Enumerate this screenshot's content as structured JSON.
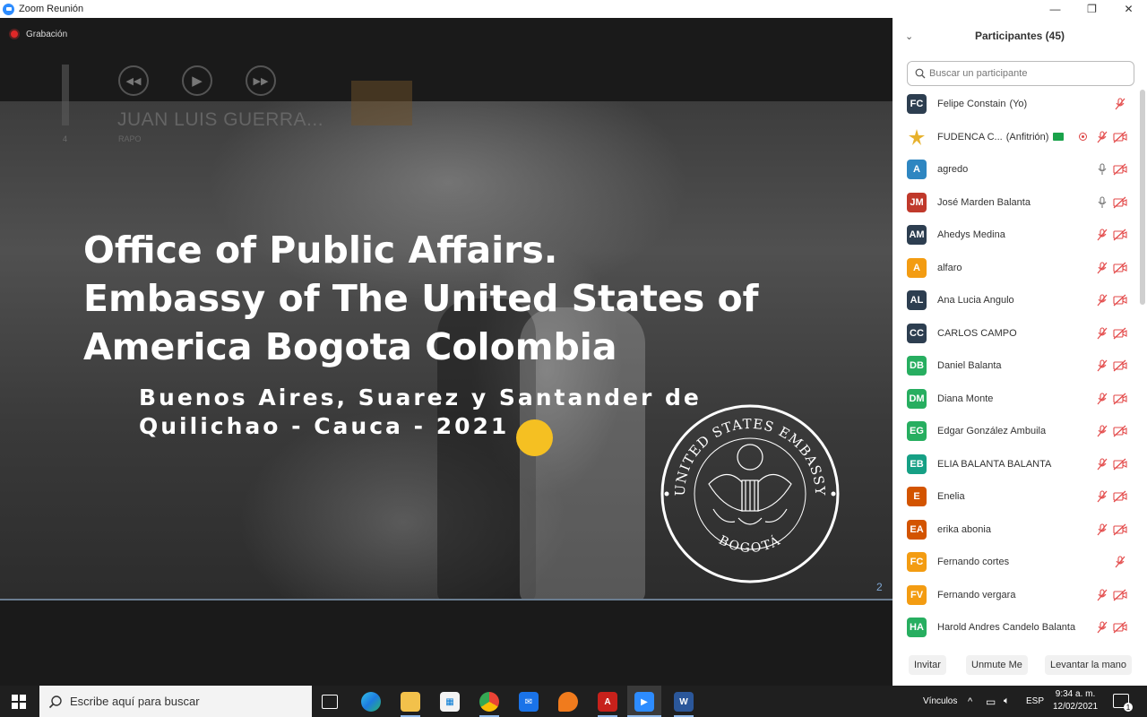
{
  "window": {
    "title": "Zoom Reunión",
    "controls": [
      "—",
      "❐",
      "✕"
    ]
  },
  "meeting": {
    "recording_label": "Grabación",
    "media": {
      "volume_number": "4",
      "song_title": "JUAN LUIS GUERRA...",
      "artist": "RAPO"
    },
    "slide": {
      "title_lines": [
        "Office of Public Affairs.",
        "Embassy of The United States of",
        "America Bogota Colombia"
      ],
      "subtitle_lines": [
        "Buenos Aires, Suarez y Santander de",
        "Quilichao - Cauca - 2021"
      ],
      "page_number": "2",
      "seal_top_text": "UNITED STATES EMBASSY",
      "seal_bottom_text": "BOGOTÁ"
    }
  },
  "panel": {
    "title": "Participantes (45)",
    "search_placeholder": "Buscar un participante",
    "participants": [
      {
        "initials": "FC",
        "name": "Felipe Constain",
        "role": "(Yo)",
        "color": "#2d3e50",
        "mic": "muted",
        "cam": "none"
      },
      {
        "initials": "FUDENCA",
        "name": "FUDENCA C...",
        "role": "(Anfitrión)",
        "color": "logo",
        "mic": "muted",
        "cam": "off",
        "host": true,
        "recording": true
      },
      {
        "initials": "A",
        "name": "agredo",
        "role": "",
        "color": "#2e86c1",
        "mic": "on",
        "cam": "off"
      },
      {
        "initials": "JM",
        "name": "José Marden Balanta",
        "role": "",
        "color": "#c0392b",
        "mic": "on",
        "cam": "off"
      },
      {
        "initials": "AM",
        "name": "Ahedys Medina",
        "role": "",
        "color": "#2d3e50",
        "mic": "muted",
        "cam": "off"
      },
      {
        "initials": "A",
        "name": "alfaro",
        "role": "",
        "color": "#f39c12",
        "mic": "muted",
        "cam": "off"
      },
      {
        "initials": "AL",
        "name": "Ana  Lucia Angulo",
        "role": "",
        "color": "#2d3e50",
        "mic": "muted",
        "cam": "off"
      },
      {
        "initials": "CC",
        "name": "CARLOS CAMPO",
        "role": "",
        "color": "#2d3e50",
        "mic": "muted",
        "cam": "off"
      },
      {
        "initials": "DB",
        "name": "Daniel Balanta",
        "role": "",
        "color": "#27ae60",
        "mic": "muted",
        "cam": "off"
      },
      {
        "initials": "DM",
        "name": "Diana Monte",
        "role": "",
        "color": "#27ae60",
        "mic": "muted",
        "cam": "off"
      },
      {
        "initials": "EG",
        "name": "Edgar González Ambuila",
        "role": "",
        "color": "#27ae60",
        "mic": "muted",
        "cam": "off"
      },
      {
        "initials": "EB",
        "name": "ELIA BALANTA BALANTA",
        "role": "",
        "color": "#16a085",
        "mic": "muted",
        "cam": "off"
      },
      {
        "initials": "E",
        "name": "Enelia",
        "role": "",
        "color": "#d35400",
        "mic": "muted",
        "cam": "off"
      },
      {
        "initials": "EA",
        "name": "erika abonia",
        "role": "",
        "color": "#d35400",
        "mic": "muted",
        "cam": "off"
      },
      {
        "initials": "FC",
        "name": "Fernando cortes",
        "role": "",
        "color": "#f39c12",
        "mic": "muted",
        "cam": "none"
      },
      {
        "initials": "FV",
        "name": "Fernando vergara",
        "role": "",
        "color": "#f39c12",
        "mic": "muted",
        "cam": "off"
      },
      {
        "initials": "HA",
        "name": "Harold Andres Candelo Balanta",
        "role": "",
        "color": "#27ae60",
        "mic": "muted",
        "cam": "off"
      }
    ],
    "footer": {
      "invite": "Invitar",
      "unmute": "Unmute Me",
      "raise_hand": "Levantar la mano"
    }
  },
  "taskbar": {
    "search_placeholder": "Escribe aquí para buscar",
    "tray_label": "Vínculos",
    "language": "ESP",
    "time": "9:34 a. m.",
    "date": "12/02/2021",
    "notification_count": "1"
  }
}
